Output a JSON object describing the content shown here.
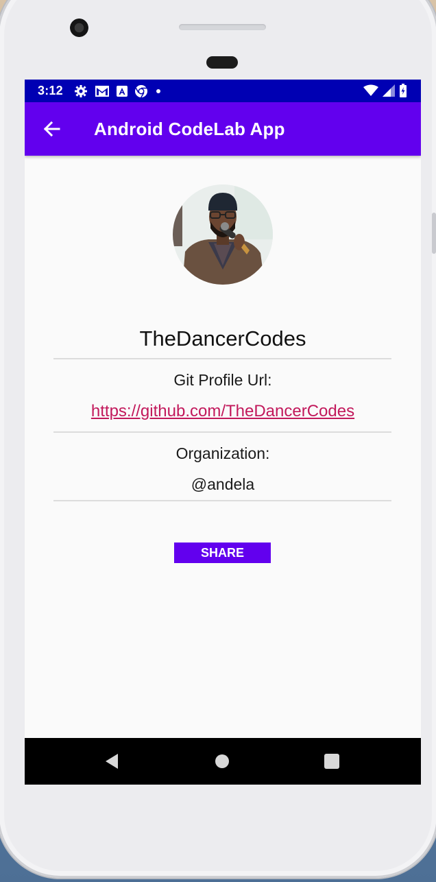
{
  "status_bar": {
    "time": "3:12",
    "left_icons": [
      "settings-icon",
      "gmail-icon",
      "autofill-icon",
      "chrome-icon",
      "dot-icon"
    ],
    "right_icons": [
      "wifi-icon",
      "signal-icon",
      "battery-icon"
    ]
  },
  "app_bar": {
    "title": "Android CodeLab App",
    "back_icon": "arrow-left-icon"
  },
  "profile": {
    "username": "TheDancerCodes",
    "git_label": "Git Profile Url:",
    "git_url": "https://github.com/TheDancerCodes",
    "org_label": "Organization:",
    "org_value": "@andela"
  },
  "actions": {
    "share_label": "SHARE"
  },
  "nav_bar": {
    "icons": [
      "nav-back-icon",
      "nav-home-icon",
      "nav-recents-icon"
    ]
  },
  "colors": {
    "status_bar": "#0000b3",
    "primary": "#6200ee",
    "link": "#c2185b"
  }
}
